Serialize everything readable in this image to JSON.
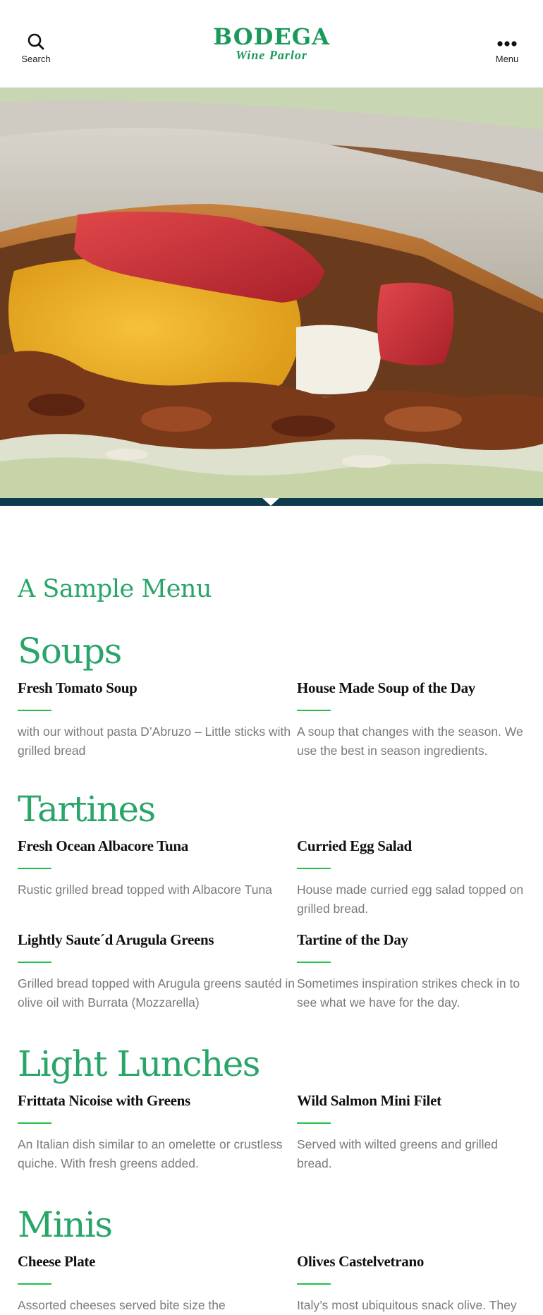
{
  "header": {
    "search_label": "Search",
    "menu_label": "Menu",
    "logo_line1": "BODEGA",
    "logo_line2": "Wine Parlor"
  },
  "hero": {
    "image": "sandwich-closeup"
  },
  "page_title": "A Sample Menu",
  "sections": [
    {
      "title": "Soups",
      "items": [
        {
          "name": "Fresh Tomato Soup",
          "desc": "with our without pasta D’Abruzo – Little sticks with grilled bread"
        },
        {
          "name": "House Made Soup of the Day",
          "desc": "A soup that changes with the season. We use the best in season ingredients."
        }
      ]
    },
    {
      "title": "Tartines",
      "items": [
        {
          "name": "Fresh Ocean Albacore Tuna",
          "desc": "Rustic grilled bread topped with Albacore Tuna"
        },
        {
          "name": "Curried Egg Salad",
          "desc": "House made curried egg salad topped on grilled bread."
        },
        {
          "name": "Lightly Saute´d Arugula Greens",
          "desc": "Grilled bread topped with Arugula greens sautéd in olive oil with Burrata (Mozzarella)"
        },
        {
          "name": "Tartine of the Day",
          "desc": "Sometimes inspiration strikes check in to see what we have for the day."
        }
      ]
    },
    {
      "title": "Light Lunches",
      "items": [
        {
          "name": "Frittata Nicoise with Greens",
          "desc": "An Italian dish similar to an omelette or crustless quiche. With fresh greens added."
        },
        {
          "name": "Wild Salmon Mini Filet",
          "desc": "Served with wilted greens and grilled bread."
        }
      ]
    },
    {
      "title": "Minis",
      "items": [
        {
          "name": "Cheese Plate",
          "desc": "Assorted cheeses served bite size the"
        },
        {
          "name": "Olives Castelvetrano",
          "desc": "Italy’s most ubiquitous snack olive. They"
        }
      ]
    }
  ],
  "colors": {
    "accent_green": "#2aa56a",
    "logo_green": "#1a9a5a",
    "rule_green": "#22c04a",
    "band_navy": "#0e3c4e",
    "desc_gray": "#7a7a7a"
  }
}
